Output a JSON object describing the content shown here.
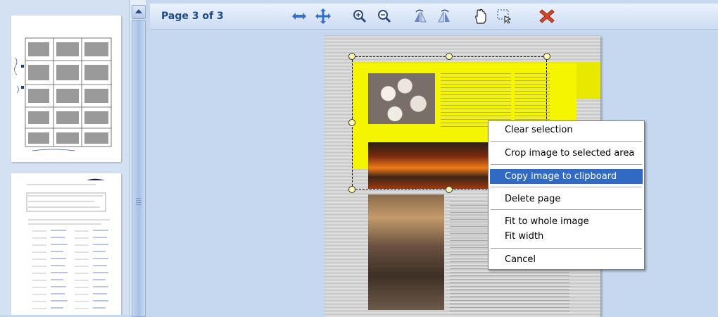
{
  "toolbar": {
    "page_indicator": "Page 3 of 3",
    "icons": [
      "fit-width-icon",
      "fit-page-icon",
      "zoom-in-icon",
      "zoom-out-icon",
      "rotate-left-icon",
      "rotate-right-icon",
      "pan-hand-icon",
      "select-area-icon",
      "close-icon"
    ]
  },
  "context_menu": {
    "items": {
      "clear_selection": "Clear selection",
      "crop_image": "Crop image to selected area",
      "copy_image": "Copy image to clipboard",
      "delete_page": "Delete page",
      "fit_whole": "Fit to whole image",
      "fit_width": "Fit width",
      "cancel": "Cancel"
    },
    "highlighted": "Copy image to clipboard",
    "highlight_color": "#316ac5"
  },
  "colors": {
    "toolbar_text": "#1d4a8c",
    "background": "#c6d8ef",
    "selection_handle": "#fff9b0"
  }
}
